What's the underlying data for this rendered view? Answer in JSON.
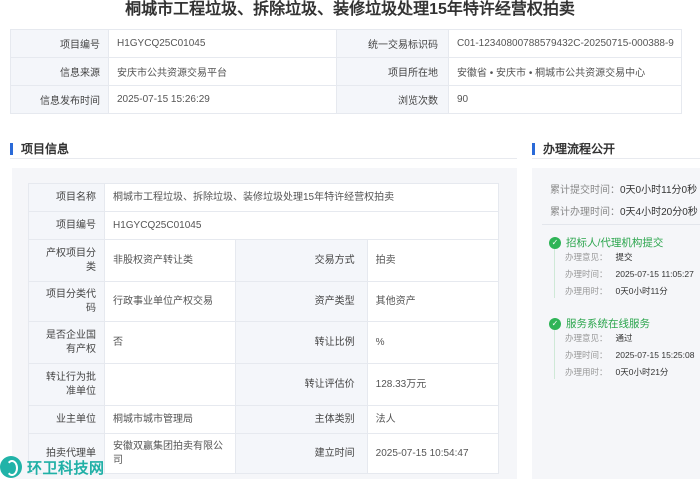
{
  "page": {
    "title": "桐城市工程垃圾、拆除垃圾、装修垃圾处理15年特许经营权拍卖"
  },
  "summary": {
    "project_no_label": "项目编号",
    "project_no": "H1GYCQ25C01045",
    "trade_id_label": "统一交易标识码",
    "trade_id": "C01-12340800788579432C-20250715-000388-9",
    "source_label": "信息来源",
    "source": "安庆市公共资源交易平台",
    "location_label": "项目所在地",
    "location": "安徽省 • 安庆市 • 桐城市公共资源交易中心",
    "publish_time_label": "信息发布时间",
    "publish_time": "2025-07-15 15:26:29",
    "views_label": "浏览次数",
    "views": "90"
  },
  "project_info": {
    "section_title": "项目信息",
    "name_label": "项目名称",
    "name": "桐城市工程垃圾、拆除垃圾、装修垃圾处理15年特许经营权拍卖",
    "no_label": "项目编号",
    "no": "H1GYCQ25C01045",
    "category_label": "产权项目分类",
    "category": "非股权资产转让类",
    "trade_method_label": "交易方式",
    "trade_method": "拍卖",
    "category_code_label": "项目分类代码",
    "category_code": "行政事业单位产权交易",
    "asset_type_label": "资产类型",
    "asset_type": "其他资产",
    "soe_label": "是否企业国有产权",
    "soe": "否",
    "transfer_ratio_label": "转让比例",
    "transfer_ratio": "%",
    "approval_label": "转让行为批准单位",
    "approval": "",
    "valuation_label": "转让评估价",
    "valuation": "128.33万元",
    "owner_label": "业主单位",
    "owner": "桐城市城市管理局",
    "entity_type_label": "主体类别",
    "entity_type": "法人",
    "agent_label": "拍卖代理单",
    "agent": "安徽双赢集团拍卖有限公司",
    "created_label": "建立时间",
    "created": "2025-07-15 10:54:47"
  },
  "process": {
    "section_title": "办理流程公开",
    "submit_time_label": "累计提交时间：",
    "submit_time": "0天0小时11分0秒",
    "handle_time_label": "累计办理时间：",
    "handle_time": "0天4小时20分0秒",
    "steps": [
      {
        "title": "招标人/代理机构提交",
        "opinion_label": "办理意见：",
        "opinion": "提交",
        "time_label": "办理时间：",
        "time": "2025-07-15 11:05:27",
        "duration_label": "办理用时：",
        "duration": "0天0小时11分"
      },
      {
        "title": "服务系统在线服务",
        "opinion_label": "办理意见：",
        "opinion": "通过",
        "time_label": "办理时间：",
        "time": "2025-07-15 15:25:08",
        "duration_label": "办理用时：",
        "duration": "0天0小时21分"
      }
    ]
  },
  "watermark": {
    "text": "环卫科技网",
    "brand_color": "#20b0a6"
  },
  "colors": {
    "accent": "#2a6ad8",
    "success": "#2fb457",
    "label_bg": "#f4f6fa"
  },
  "icons": {
    "step_status": "check-circle-icon"
  }
}
